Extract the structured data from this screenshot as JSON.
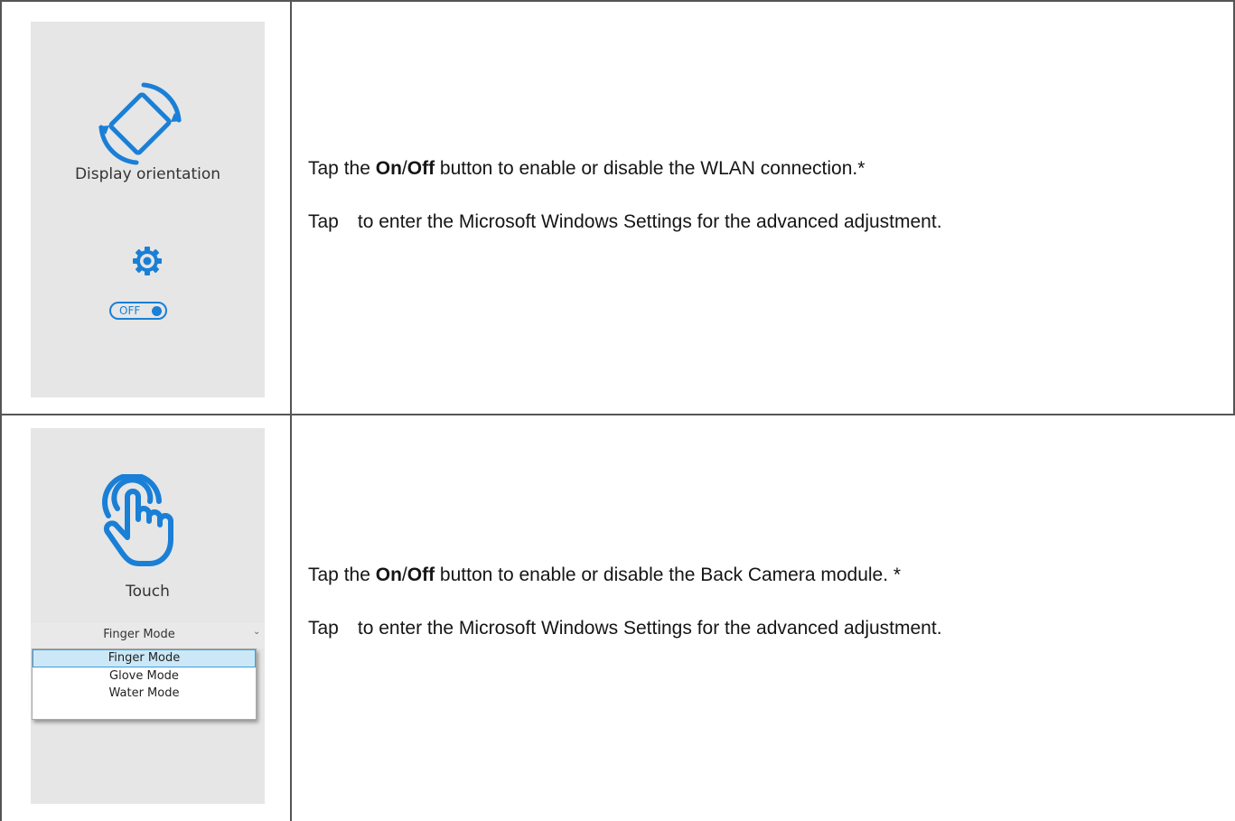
{
  "rows": [
    {
      "panel_label": "Display orientation",
      "toggle_label": "OFF",
      "line1": {
        "prefix": "Tap the ",
        "on": "On",
        "slash": "/",
        "off": "Off",
        "suffix": " button to enable or disable the WLAN connection.*"
      },
      "line2": {
        "prefix": "Tap",
        "suffix": "to enter the Microsoft Windows Settings for the advanced adjustment."
      }
    },
    {
      "panel_label": "Touch",
      "select_value": "Finger Mode",
      "options": [
        "Finger Mode",
        "Glove Mode",
        "Water Mode"
      ],
      "line1": {
        "prefix": "Tap the ",
        "on": "On",
        "slash": "/",
        "off": "Off",
        "suffix": " button to enable or disable the Back Camera module. *"
      },
      "line2": {
        "prefix": "Tap",
        "suffix": "to enter the Microsoft Windows Settings for the advanced adjustment."
      }
    }
  ],
  "icons": {
    "rotate": "rotate-screen-icon",
    "gear": "gear-icon",
    "touch": "touch-hand-icon",
    "chevron": "chevron-down-icon"
  },
  "colors": {
    "accent": "#1a7fd6",
    "panel": "#e6e6e6",
    "border": "#555555",
    "selected_option": "#cce8f7"
  }
}
